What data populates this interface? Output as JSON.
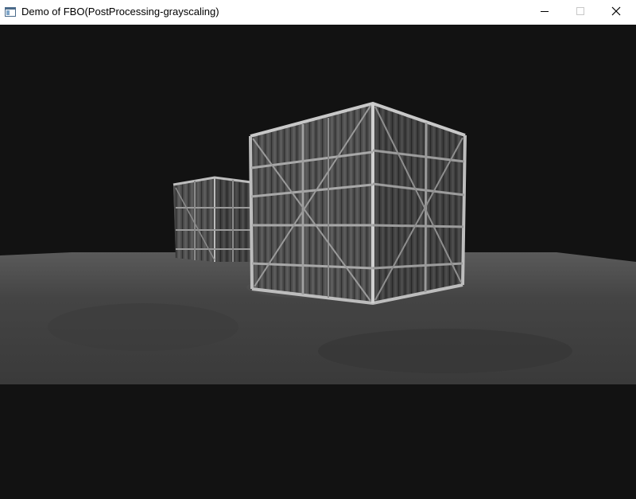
{
  "window": {
    "title": "Demo of FBO(PostProcessing-grayscaling)",
    "icons": {
      "app": "app-window-icon",
      "minimize": "minimize-icon",
      "maximize": "maximize-icon",
      "close": "close-icon"
    }
  },
  "viewport": {
    "background_color": "#121212",
    "floor_color": "#4a4a4a",
    "crate_color": "#5a5a5a",
    "frame_color": "#bdbdbd"
  }
}
